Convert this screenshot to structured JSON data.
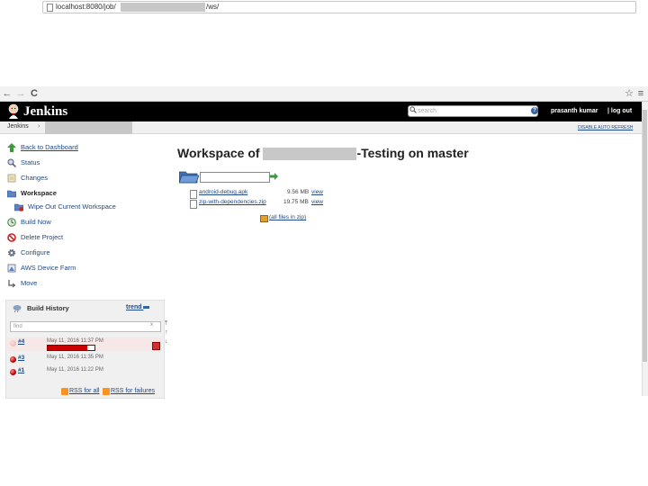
{
  "browser": {
    "url_prefix": "localhost:8080/job/",
    "url_suffix": "/ws/",
    "back_glyph": "←",
    "forward_glyph": "→",
    "reload_glyph": "C",
    "star_glyph": "☆",
    "menu_glyph": "≡"
  },
  "header": {
    "logo_text": "Jenkins",
    "search_placeholder": "search",
    "help_glyph": "?",
    "user_name": "prasanth kumar",
    "logout": "| log out"
  },
  "breadcrumb": {
    "root": "Jenkins",
    "separator": "›",
    "auto_refresh": "DISABLE AUTO REFRESH"
  },
  "sidebar": {
    "items": [
      {
        "label": "Back to Dashboard",
        "icon": "up-arrow-icon"
      },
      {
        "label": "Status",
        "icon": "magnifier-icon"
      },
      {
        "label": "Changes",
        "icon": "notepad-icon"
      },
      {
        "label": "Workspace",
        "icon": "folder-icon"
      },
      {
        "label": "Wipe Out Current Workspace",
        "icon": "wipe-folder-icon"
      },
      {
        "label": "Build Now",
        "icon": "clock-icon"
      },
      {
        "label": "Delete Project",
        "icon": "no-entry-icon"
      },
      {
        "label": "Configure",
        "icon": "gear-icon"
      },
      {
        "label": "AWS Device Farm",
        "icon": "device-farm-icon"
      },
      {
        "label": "Move",
        "icon": "move-icon"
      }
    ]
  },
  "build_history": {
    "title": "Build History",
    "trend": "trend",
    "find_placeholder": "find",
    "find_clear": "x",
    "builds": [
      {
        "number": "#4",
        "date": "May 11, 2016 11:37 PM",
        "status": "in-progress"
      },
      {
        "number": "#3",
        "date": "May 11, 2016 11:35 PM",
        "status": "failed"
      },
      {
        "number": "#1",
        "date": "May 11, 2016 11:22 PM",
        "status": "failed"
      }
    ],
    "progress": 0.85,
    "rss_all": "RSS for all",
    "rss_failures": "RSS for failures",
    "scroll_top": "⤒",
    "scroll_up": "↑",
    "scroll_down": "↓"
  },
  "main": {
    "title_prefix": "Workspace of",
    "title_suffix": "-Testing on master",
    "files": [
      {
        "name": "android-debug.apk",
        "size": "9.56 MB",
        "view": "view"
      },
      {
        "name": "zip-with-dependencies.zip",
        "size": "19.75 MB",
        "view": "view"
      }
    ],
    "all_files_zip": "(all files in zip)"
  },
  "colors": {
    "header_bg": "#000000",
    "link": "#204a87",
    "failed": "#cc0000"
  }
}
